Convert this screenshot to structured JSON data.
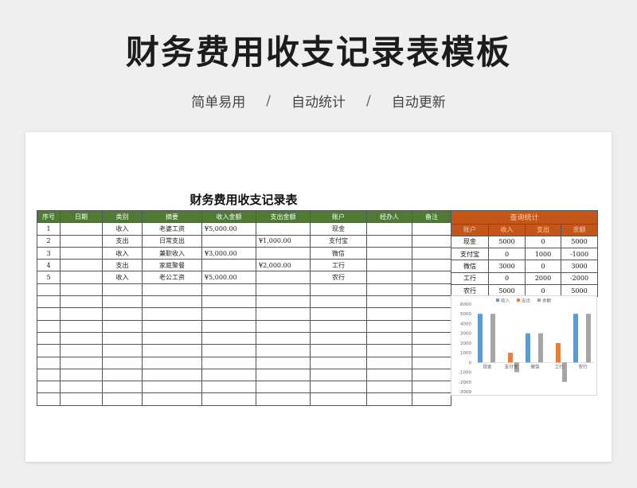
{
  "hero": {
    "title": "财务费用收支记录表模板",
    "tags": [
      "简单易用",
      "自动统计",
      "自动更新"
    ],
    "separator": "/"
  },
  "sheet": {
    "title": "财务费用收支记录表",
    "columns": [
      "序号",
      "日期",
      "类别",
      "摘要",
      "收入金额",
      "支出金额",
      "账户",
      "经办人",
      "备注"
    ],
    "rows": [
      {
        "no": "1",
        "date": "",
        "type": "收入",
        "summary": "老婆工资",
        "income": "¥5,000.00",
        "expense": "",
        "account": "现金",
        "handler": "",
        "note": ""
      },
      {
        "no": "2",
        "date": "",
        "type": "支出",
        "summary": "日常支出",
        "income": "",
        "expense": "¥1,000.00",
        "account": "支付宝",
        "handler": "",
        "note": ""
      },
      {
        "no": "3",
        "date": "",
        "type": "收入",
        "summary": "兼职收入",
        "income": "¥3,000.00",
        "expense": "",
        "account": "微信",
        "handler": "",
        "note": ""
      },
      {
        "no": "4",
        "date": "",
        "type": "支出",
        "summary": "家庭聚餐",
        "income": "",
        "expense": "¥2,000.00",
        "account": "工行",
        "handler": "",
        "note": ""
      },
      {
        "no": "5",
        "date": "",
        "type": "收入",
        "summary": "老公工资",
        "income": "¥5,000.00",
        "expense": "",
        "account": "农行",
        "handler": "",
        "note": ""
      }
    ],
    "empty_rows": 10
  },
  "stats": {
    "title": "查询统计",
    "columns": [
      "账户",
      "收入",
      "支出",
      "余额"
    ],
    "rows": [
      [
        "现金",
        "5000",
        "0",
        "5000"
      ],
      [
        "支付宝",
        "0",
        "1000",
        "-1000"
      ],
      [
        "微信",
        "3000",
        "0",
        "3000"
      ],
      [
        "工行",
        "0",
        "2000",
        "-2000"
      ],
      [
        "农行",
        "5000",
        "0",
        "5000"
      ]
    ]
  },
  "colors": {
    "header_green": "#4e7a34",
    "stats_orange": "#c4561a",
    "income_series": "#5b9bd5",
    "expense_series": "#ed7d31",
    "balance_series": "#a5a5a5"
  },
  "chart_data": {
    "type": "bar",
    "categories": [
      "现金",
      "支付宝",
      "微信",
      "工行",
      "农行"
    ],
    "series": [
      {
        "name": "收入",
        "values": [
          5000,
          0,
          3000,
          0,
          5000
        ]
      },
      {
        "name": "支出",
        "values": [
          0,
          1000,
          0,
          2000,
          0
        ]
      },
      {
        "name": "余额",
        "values": [
          5000,
          -1000,
          3000,
          -2000,
          5000
        ]
      }
    ],
    "ylim": [
      -3000,
      6000
    ],
    "yticks": [
      6000,
      5000,
      4000,
      3000,
      2000,
      1000,
      0,
      -1000,
      -2000,
      -3000
    ],
    "legend": "top",
    "grid": false
  }
}
